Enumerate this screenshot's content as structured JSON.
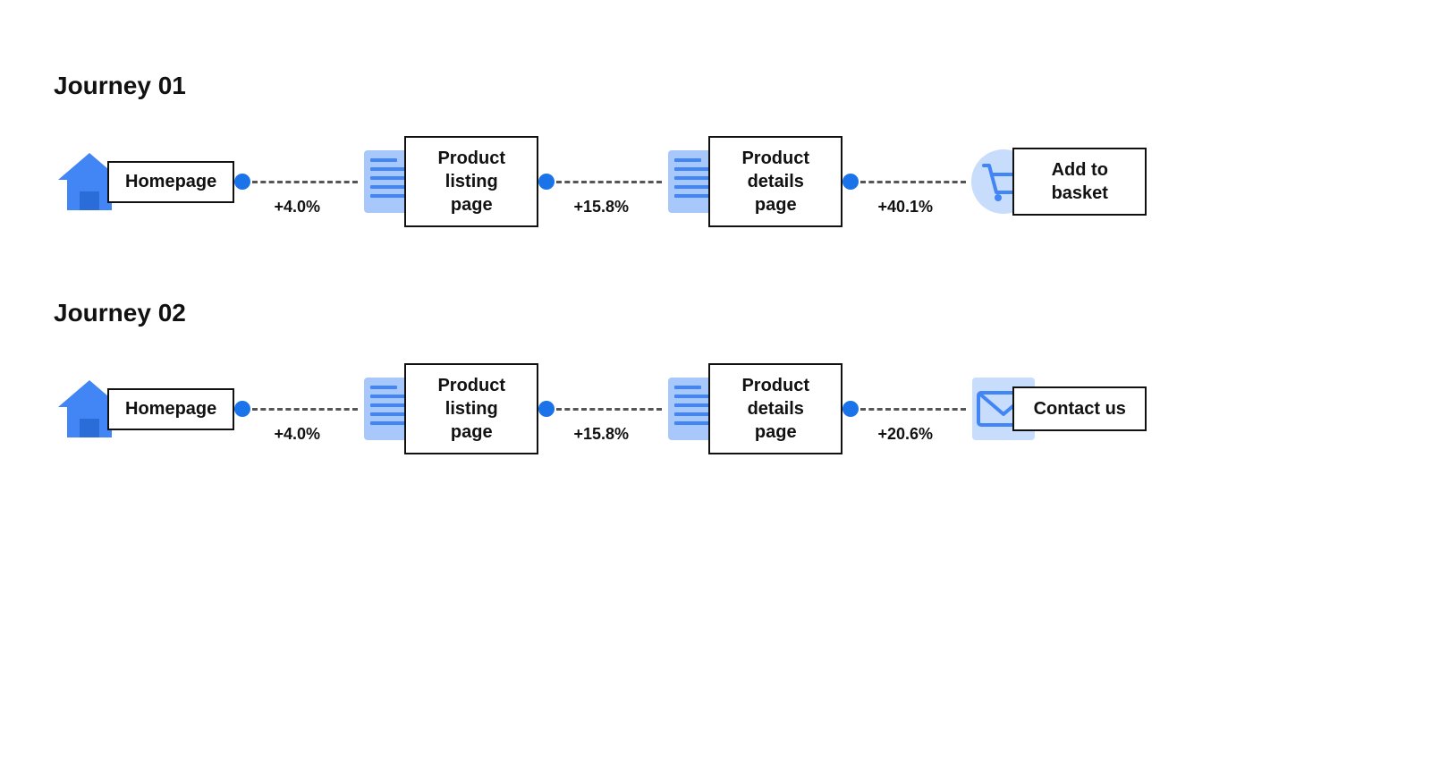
{
  "journeys": [
    {
      "id": "journey-01",
      "title": "Journey 01",
      "nodes": [
        {
          "id": "homepage-1",
          "type": "home",
          "label": "Homepage",
          "label_lines": 1
        },
        {
          "id": "product-listing-1",
          "type": "page",
          "label": "Product\nlisting page",
          "label_lines": 2
        },
        {
          "id": "product-details-1",
          "type": "page",
          "label": "Product\ndetails page",
          "label_lines": 2
        },
        {
          "id": "add-to-basket",
          "type": "cart",
          "label": "Add to\nbasket",
          "label_lines": 2
        }
      ],
      "connectors": [
        {
          "id": "conn-1-1",
          "percent": "+4.0%"
        },
        {
          "id": "conn-1-2",
          "percent": "+15.8%"
        },
        {
          "id": "conn-1-3",
          "percent": "+40.1%"
        }
      ]
    },
    {
      "id": "journey-02",
      "title": "Journey 02",
      "nodes": [
        {
          "id": "homepage-2",
          "type": "home",
          "label": "Homepage",
          "label_lines": 1
        },
        {
          "id": "product-listing-2",
          "type": "page",
          "label": "Product\nlisting page",
          "label_lines": 2
        },
        {
          "id": "product-details-2",
          "type": "page",
          "label": "Product\ndetails page",
          "label_lines": 2
        },
        {
          "id": "contact-us",
          "type": "mail",
          "label": "Contact\nus",
          "label_lines": 2
        }
      ],
      "connectors": [
        {
          "id": "conn-2-1",
          "percent": "+4.0%"
        },
        {
          "id": "conn-2-2",
          "percent": "+15.8%"
        },
        {
          "id": "conn-2-3",
          "percent": "+20.6%"
        }
      ]
    }
  ]
}
